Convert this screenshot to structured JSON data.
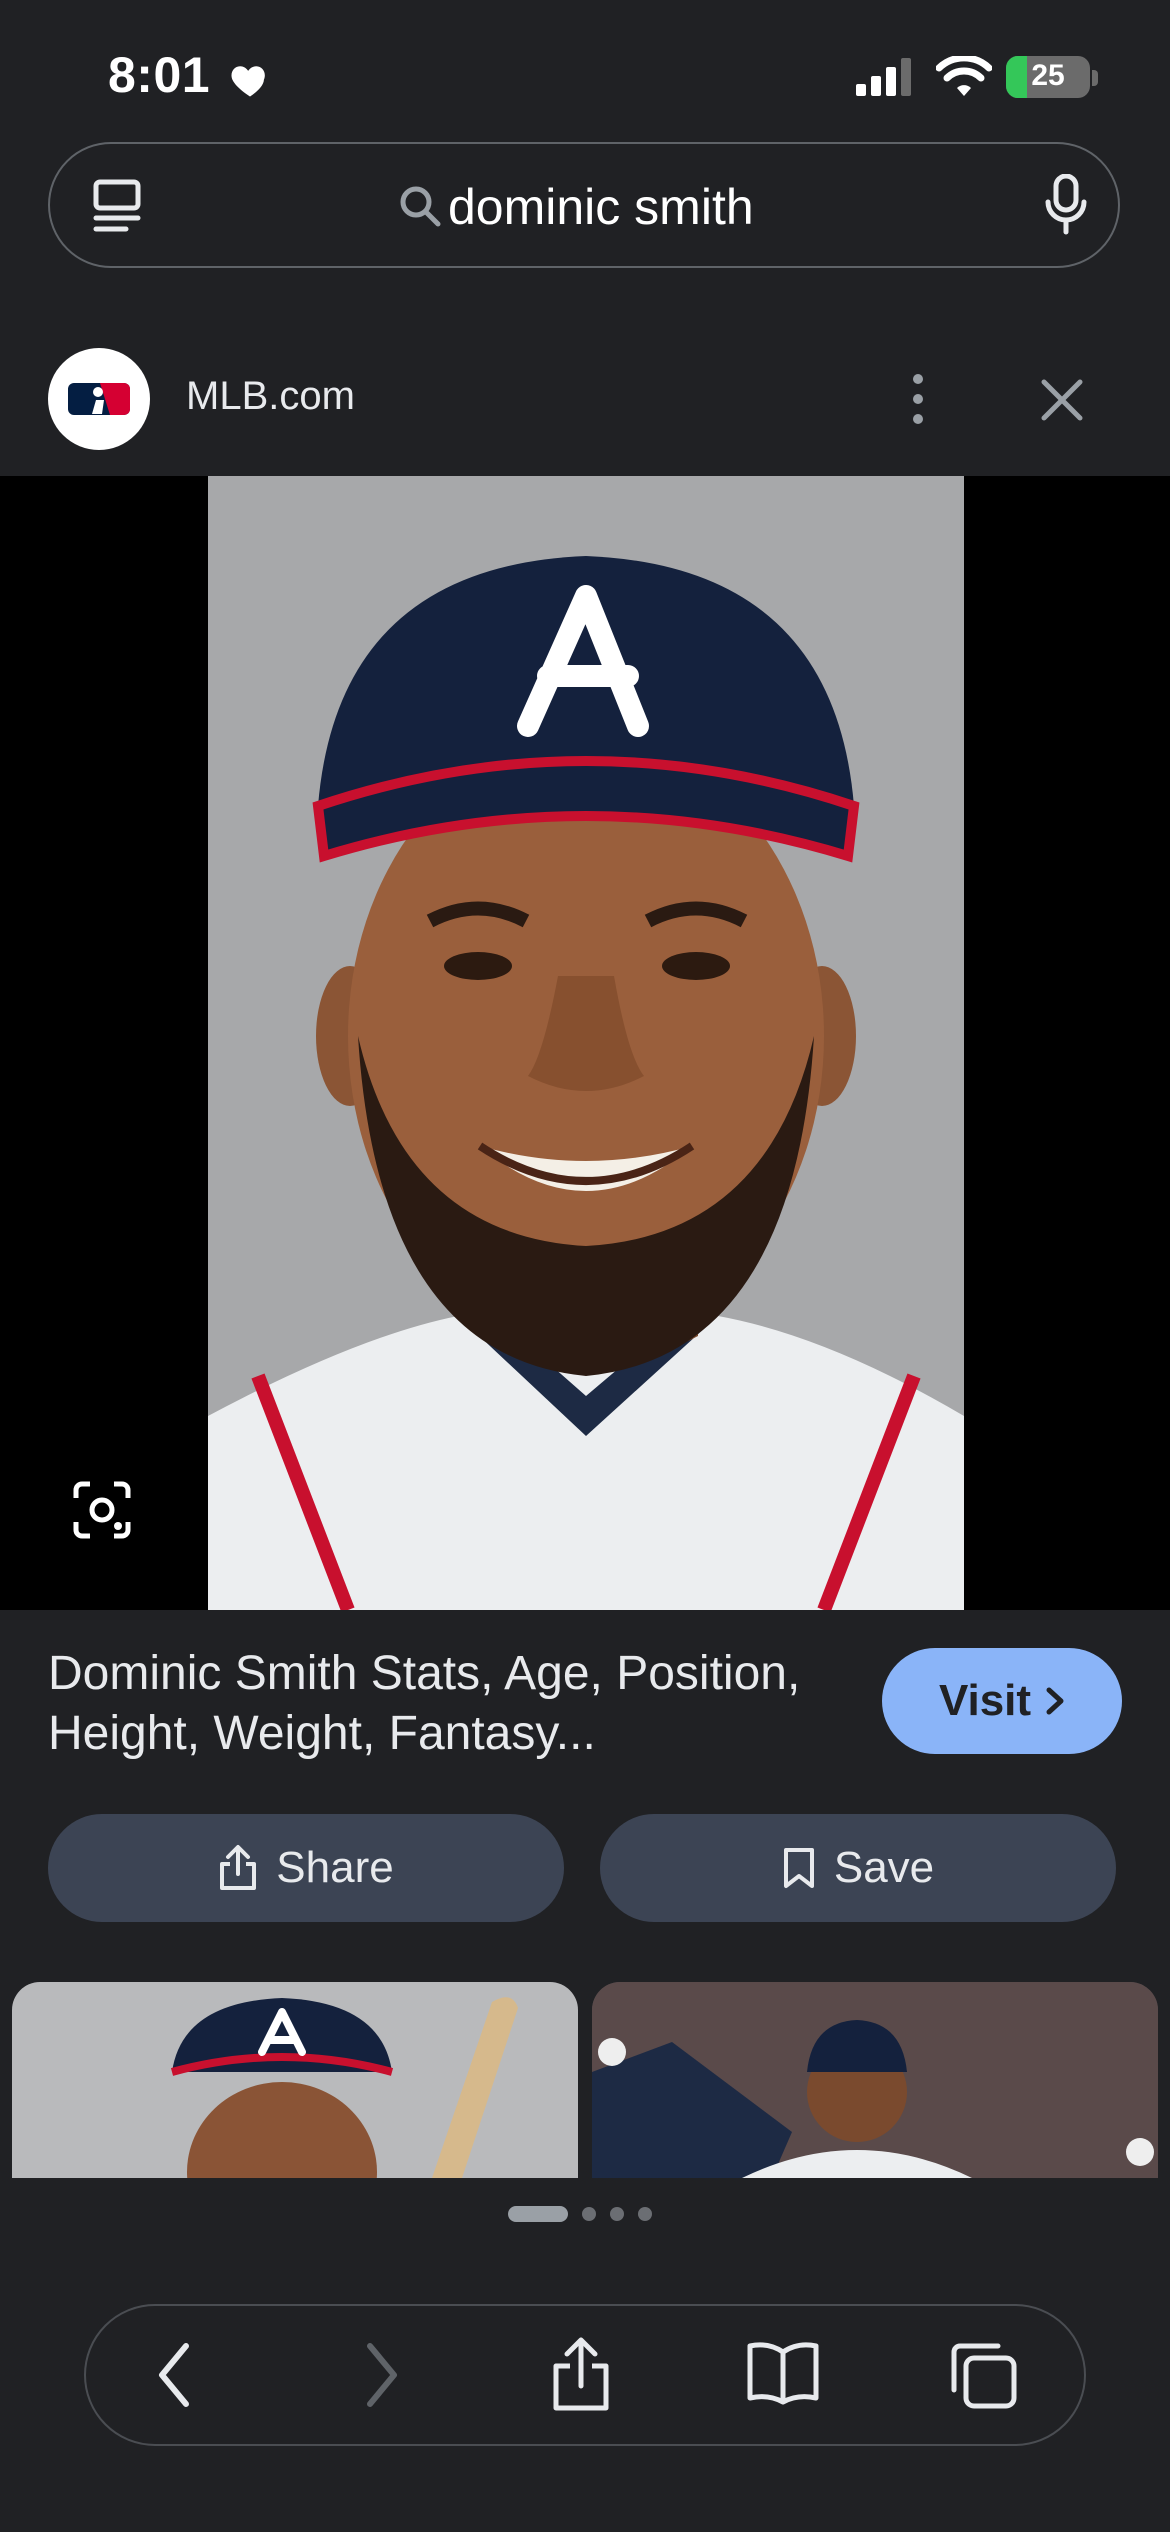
{
  "status_bar": {
    "time": "8:01",
    "battery_level": "25",
    "battery_fraction": 0.25,
    "icons": [
      "heart-icon",
      "cellular-signal-icon",
      "wifi-icon",
      "battery-charging-icon"
    ]
  },
  "search": {
    "query": "dominic smith",
    "icons": [
      "tabs-icon",
      "search-icon",
      "microphone-icon"
    ]
  },
  "source": {
    "name": "MLB.com",
    "icons": [
      "mlb-logo",
      "more-vert-icon",
      "close-icon"
    ]
  },
  "result": {
    "title": "Dominic Smith Stats, Age, Position, Height, Weight, Fantasy...",
    "visit_label": "Visit",
    "share_label": "Share",
    "save_label": "Save"
  },
  "carousel": {
    "page_count": 4,
    "active_page": 1
  },
  "toolbar": {
    "icons": [
      "back-icon",
      "forward-icon",
      "share-icon",
      "bookmarks-icon",
      "tabs-overview-icon"
    ]
  },
  "colors": {
    "background": "#202124",
    "accent": "#8ab4f8",
    "button": "#3c4454",
    "battery": "#34c759"
  }
}
